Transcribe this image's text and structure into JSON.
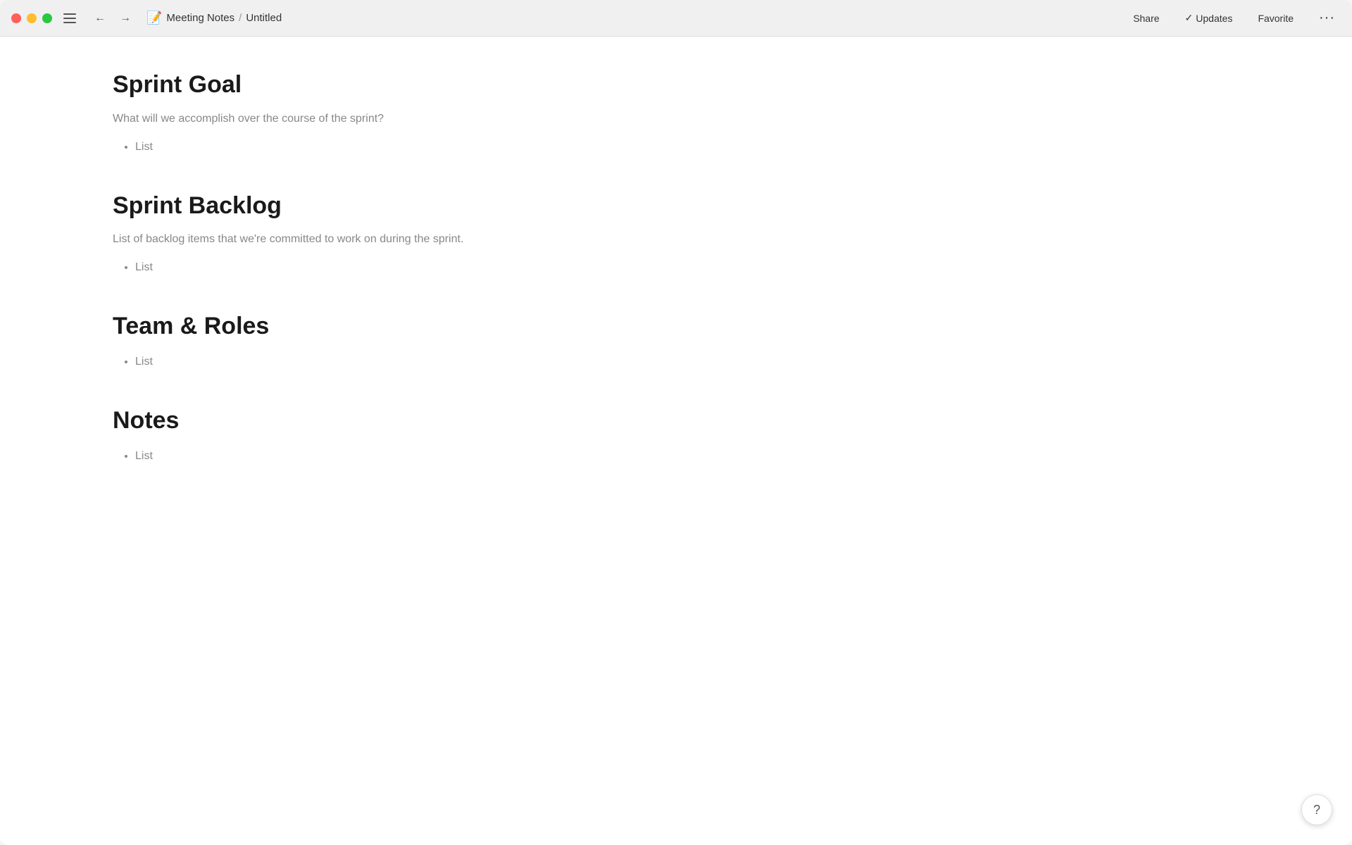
{
  "titlebar": {
    "icon": "📝",
    "breadcrumb_parent": "Meeting Notes",
    "breadcrumb_separator": "/",
    "breadcrumb_current": "Untitled",
    "share_label": "Share",
    "updates_label": "Updates",
    "favorite_label": "Favorite",
    "more_label": "···"
  },
  "content": {
    "sections": [
      {
        "id": "sprint-goal",
        "heading": "Sprint Goal",
        "description": "What will we accomplish over the course of the sprint?",
        "list_item": "List"
      },
      {
        "id": "sprint-backlog",
        "heading": "Sprint Backlog",
        "description": "List of backlog items that we're committed to work on during the sprint.",
        "list_item": "List"
      },
      {
        "id": "team-roles",
        "heading": "Team & Roles",
        "description": "",
        "list_item": "List"
      },
      {
        "id": "notes",
        "heading": "Notes",
        "description": "",
        "list_item": "List"
      }
    ]
  },
  "help": {
    "label": "?"
  }
}
